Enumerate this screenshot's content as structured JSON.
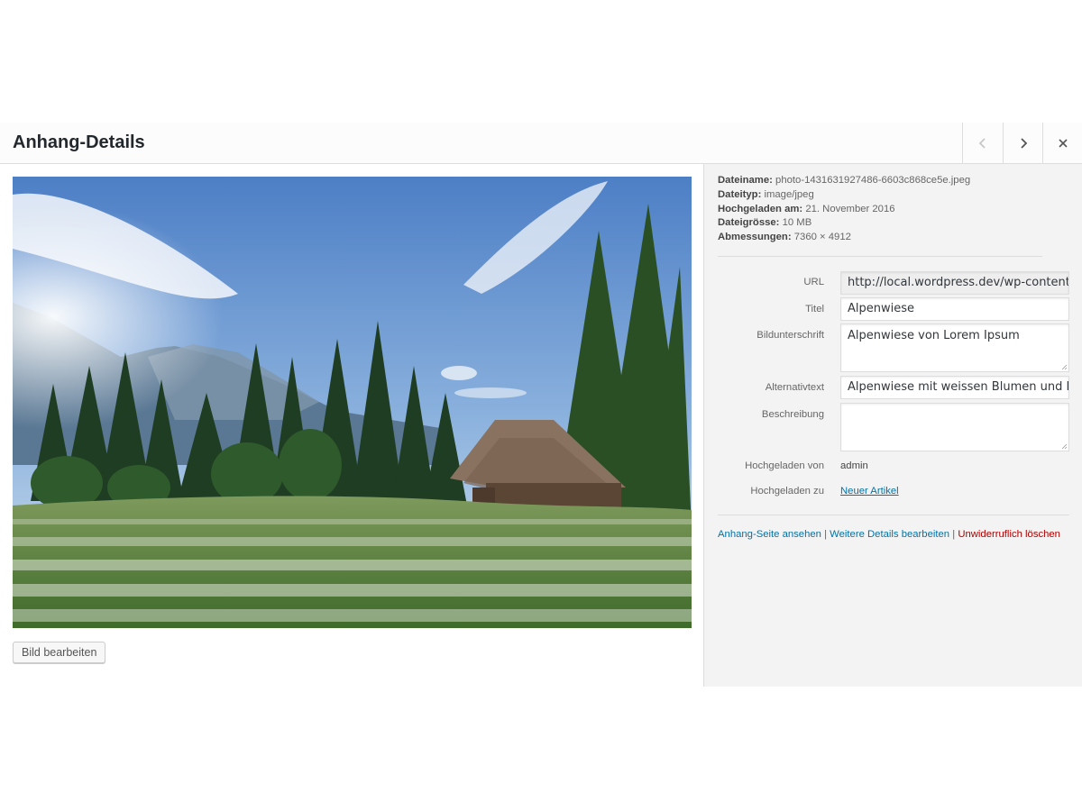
{
  "header": {
    "title": "Anhang-Details"
  },
  "image": {
    "alt": "Alpenwiese mit weissen Blumen und Holzhütte"
  },
  "left": {
    "edit_button": "Bild bearbeiten"
  },
  "details": {
    "filename_label": "Dateiname:",
    "filename": "photo-1431631927486-6603c868ce5e.jpeg",
    "filetype_label": "Dateityp:",
    "filetype": "image/jpeg",
    "uploaded_on_label": "Hochgeladen am:",
    "uploaded_on": "21. November 2016",
    "filesize_label": "Dateigrösse:",
    "filesize": "10 MB",
    "dimensions_label": "Abmessungen:",
    "dimensions": "7360 × 4912"
  },
  "form": {
    "url_label": "URL",
    "url_value": "http://local.wordpress.dev/wp-content/up",
    "title_label": "Titel",
    "title_value": "Alpenwiese",
    "caption_label": "Bildunterschrift",
    "caption_value": "Alpenwiese von Lorem Ipsum",
    "alt_label": "Alternativtext",
    "alt_value": "Alpenwiese mit weissen Blumen und Holz",
    "description_label": "Beschreibung",
    "description_value": "",
    "uploaded_by_label": "Hochgeladen von",
    "uploaded_by_value": "admin",
    "uploaded_to_label": "Hochgeladen zu",
    "uploaded_to_value": "Neuer Artikel"
  },
  "actions": {
    "view_page": "Anhang-Seite ansehen",
    "sep1": "|",
    "edit_more": "Weitere Details bearbeiten",
    "sep2": "|",
    "delete": "Unwiderruflich löschen"
  },
  "colors": {
    "link": "#0073aa",
    "delete": "#aa0000",
    "sidebar_bg": "#f3f3f3"
  }
}
